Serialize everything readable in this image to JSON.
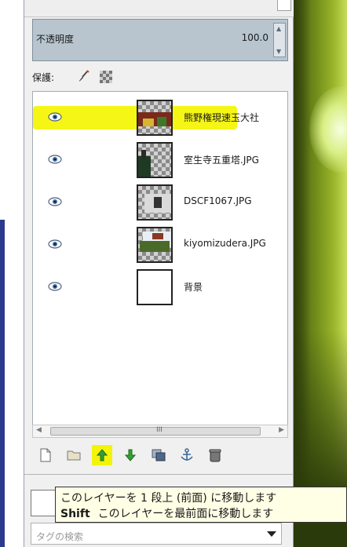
{
  "opacity": {
    "label": "不透明度",
    "value": "100.0"
  },
  "lock": {
    "label": "保護:"
  },
  "layers": [
    {
      "name": "熊野権現速玉大社",
      "visible": true,
      "highlighted": true
    },
    {
      "name": "室生寺五重塔.JPG",
      "visible": true,
      "highlighted": false
    },
    {
      "name": "DSCF1067.JPG",
      "visible": true,
      "highlighted": false
    },
    {
      "name": "kiyomizudera.JPG",
      "visible": true,
      "highlighted": false
    },
    {
      "name": "背景",
      "visible": true,
      "highlighted": false
    }
  ],
  "scrollbar": {
    "grip": "III"
  },
  "toolbar": {
    "buttons": [
      "new-layer",
      "new-layer-group",
      "raise-layer",
      "lower-layer",
      "duplicate-layer",
      "anchor-layer",
      "delete-layer"
    ],
    "highlighted": "raise-layer"
  },
  "tooltip": {
    "line1": "このレイヤーを 1 段上 (前面) に移動します",
    "shift_key": "Shift",
    "line2": "このレイヤーを最前面に移動します"
  },
  "tag_field": {
    "placeholder": "タグの検索"
  },
  "colors": {
    "highlight": "#f6f60a",
    "panel": "#f0f0f0",
    "opacity_box": "#b8c5cf"
  }
}
